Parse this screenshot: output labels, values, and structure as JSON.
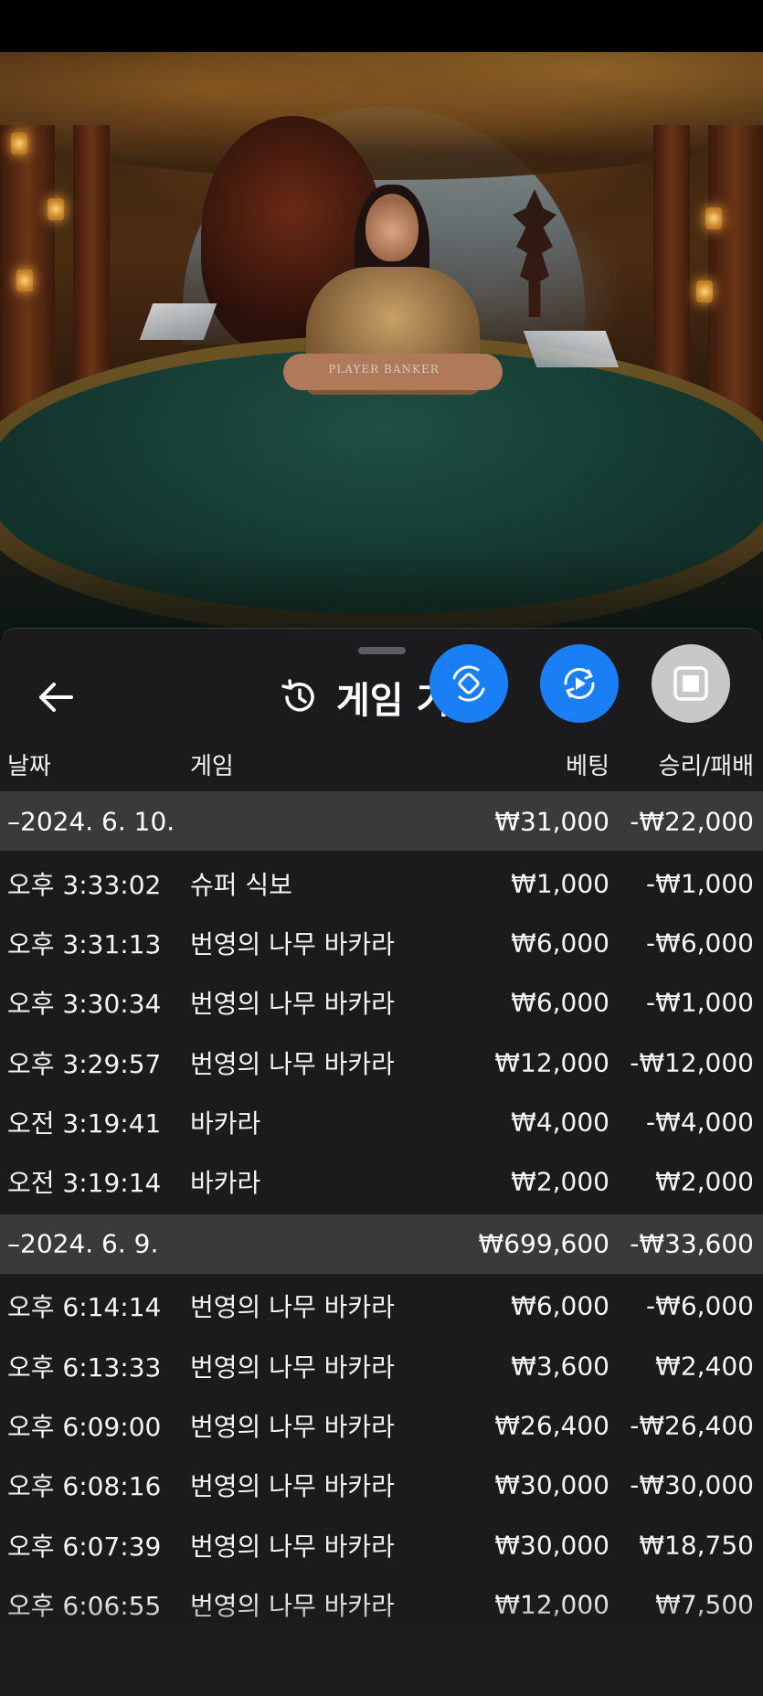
{
  "table_felt_text": "PLAYER  BANKER",
  "panel": {
    "title": "게임 기록",
    "columns": {
      "date": "날짜",
      "game": "게임",
      "bet": "베팅",
      "result": "승리/패배"
    },
    "groups": [
      {
        "date": "–2024. 6. 10.",
        "bet_total": "₩31,000",
        "result_total": "-₩22,000",
        "rows": [
          {
            "time": "오후 3:33:02",
            "game": "슈퍼 식보",
            "bet": "₩1,000",
            "result": "-₩1,000"
          },
          {
            "time": "오후 3:31:13",
            "game": "번영의 나무 바카라",
            "bet": "₩6,000",
            "result": "-₩6,000"
          },
          {
            "time": "오후 3:30:34",
            "game": "번영의 나무 바카라",
            "bet": "₩6,000",
            "result": "-₩1,000"
          },
          {
            "time": "오후 3:29:57",
            "game": "번영의 나무 바카라",
            "bet": "₩12,000",
            "result": "-₩12,000"
          },
          {
            "time": "오전 3:19:41",
            "game": "바카라",
            "bet": "₩4,000",
            "result": "-₩4,000"
          },
          {
            "time": "오전 3:19:14",
            "game": "바카라",
            "bet": "₩2,000",
            "result": "₩2,000"
          }
        ]
      },
      {
        "date": "–2024. 6. 9.",
        "bet_total": "₩699,600",
        "result_total": "-₩33,600",
        "rows": [
          {
            "time": "오후 6:14:14",
            "game": "번영의 나무 바카라",
            "bet": "₩6,000",
            "result": "-₩6,000"
          },
          {
            "time": "오후 6:13:33",
            "game": "번영의 나무 바카라",
            "bet": "₩3,600",
            "result": "₩2,400"
          },
          {
            "time": "오후 6:09:00",
            "game": "번영의 나무 바카라",
            "bet": "₩26,400",
            "result": "-₩26,400"
          },
          {
            "time": "오후 6:08:16",
            "game": "번영의 나무 바카라",
            "bet": "₩30,000",
            "result": "-₩30,000"
          },
          {
            "time": "오후 6:07:39",
            "game": "번영의 나무 바카라",
            "bet": "₩30,000",
            "result": "₩18,750"
          },
          {
            "time": "오후 6:06:55",
            "game": "번영의 나무 바카라",
            "bet": "₩12,000",
            "result": "₩7,500"
          }
        ]
      }
    ]
  },
  "icons": {
    "back": "arrow-left-icon",
    "history": "history-clock-icon",
    "swap": "swap-rotate-icon",
    "replay": "replay-play-icon",
    "stop": "stop-square-icon"
  },
  "colors": {
    "accent_blue": "#1a7ff5",
    "panel_bg": "#1c1c1e",
    "group_header_bg": "#3a3a3c"
  }
}
